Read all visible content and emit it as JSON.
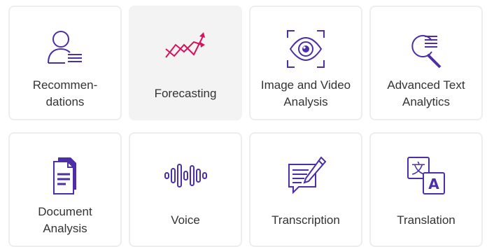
{
  "colors": {
    "icon_primary": "#4b2ea8",
    "icon_accent": "#d6125c",
    "tile_border": "#eeeeee",
    "tile_active_bg": "#f3f3f3",
    "text": "#333333"
  },
  "tiles": [
    {
      "label": "Recommen-\ndations",
      "icon": "user-list-icon",
      "active": false
    },
    {
      "label": "Forecasting",
      "icon": "trend-arrows-icon",
      "active": true
    },
    {
      "label": "Image and Video\nAnalysis",
      "icon": "eye-scan-icon",
      "active": false
    },
    {
      "label": "Advanced Text\nAnalytics",
      "icon": "magnifier-text-icon",
      "active": false
    },
    {
      "label": "Document\nAnalysis",
      "icon": "document-icon",
      "active": false
    },
    {
      "label": "Voice",
      "icon": "sound-wave-icon",
      "active": false
    },
    {
      "label": "Transcription",
      "icon": "pen-notepad-icon",
      "active": false
    },
    {
      "label": "Translation",
      "icon": "translate-icon",
      "active": false
    }
  ]
}
